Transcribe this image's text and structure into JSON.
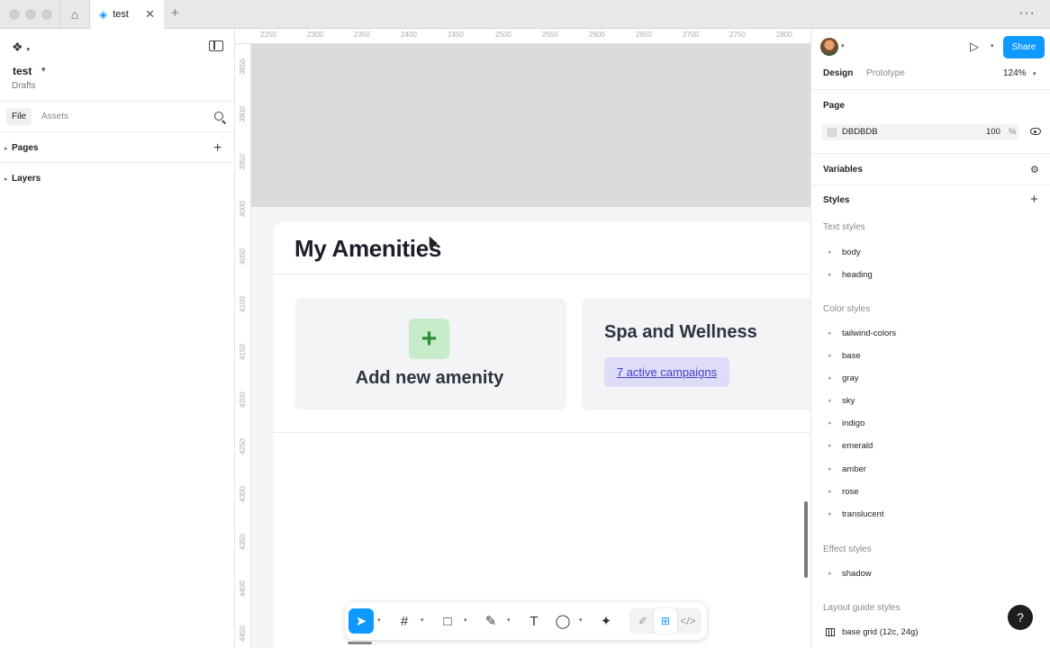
{
  "tab": {
    "title": "test"
  },
  "file": {
    "name": "test",
    "location": "Drafts"
  },
  "left_panel": {
    "tabs": [
      "File",
      "Assets"
    ],
    "sections": [
      {
        "label": "Pages"
      },
      {
        "label": "Layers"
      }
    ]
  },
  "rulers": {
    "top": [
      "2250",
      "2300",
      "2350",
      "2400",
      "2450",
      "2500",
      "2550",
      "2600",
      "2650",
      "2700",
      "2750",
      "2800"
    ],
    "left": [
      "3850",
      "3900",
      "3950",
      "4000",
      "4050",
      "4100",
      "4150",
      "4200",
      "4250",
      "4300",
      "4350",
      "4400",
      "4450"
    ]
  },
  "canvas": {
    "frame_title": "My Amenities",
    "add_card": {
      "icon": "+",
      "label": "Add new amenity"
    },
    "spa_card": {
      "title": "Spa and Wellness",
      "badge": "7 active campaigns"
    }
  },
  "toolbar": {
    "tools": [
      {
        "name": "move-tool",
        "glyph": "➤"
      },
      {
        "name": "frame-tool",
        "glyph": "#"
      },
      {
        "name": "shape-tool",
        "glyph": "□"
      },
      {
        "name": "pen-tool",
        "glyph": "✎"
      },
      {
        "name": "text-tool",
        "glyph": "T"
      },
      {
        "name": "comment-tool",
        "glyph": "◯"
      },
      {
        "name": "actions-tool",
        "glyph": "✦"
      }
    ],
    "modes": [
      {
        "name": "draw-mode",
        "glyph": "✐"
      },
      {
        "name": "design-mode",
        "glyph": "⊞"
      },
      {
        "name": "dev-mode",
        "glyph": "</>"
      }
    ]
  },
  "right_panel": {
    "share_label": "Share",
    "tabs": {
      "design": "Design",
      "prototype": "Prototype"
    },
    "zoom": "124%",
    "page": {
      "heading": "Page",
      "fill_hex": "DBDBDB",
      "fill_opacity": "100",
      "fill_unit": "%",
      "fill_color": "#DBDBDB"
    },
    "variables_heading": "Variables",
    "styles_heading": "Styles",
    "text_styles": {
      "label": "Text styles",
      "items": [
        "body",
        "heading"
      ]
    },
    "color_styles": {
      "label": "Color styles",
      "items": [
        "tailwind-colors",
        "base",
        "gray",
        "sky",
        "indigo",
        "emerald",
        "amber",
        "rose",
        "translucent"
      ]
    },
    "effect_styles": {
      "label": "Effect styles",
      "items": [
        "shadow"
      ]
    },
    "layout_guide_styles": {
      "label": "Layout guide styles",
      "items": [
        "base grid (12c, 24g)"
      ]
    },
    "help_label": "?"
  },
  "colors": {
    "accent": "#0D99FF",
    "canvas_bg": "#DBDBDB",
    "badge_bg": "#DEDCF8",
    "badge_text": "#4540C9",
    "plus_bg": "#C7ECC9"
  }
}
